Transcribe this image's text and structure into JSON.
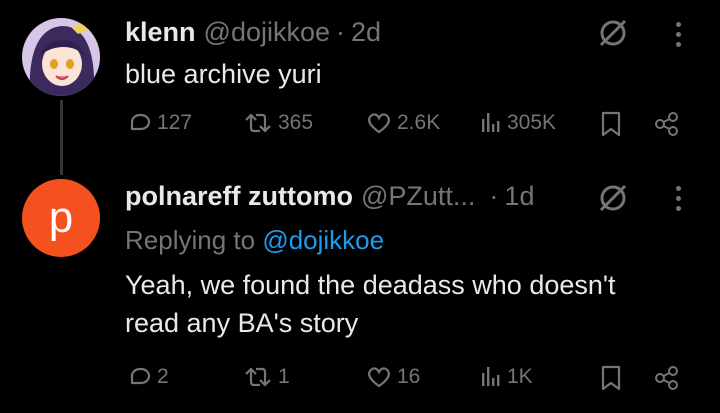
{
  "tweets": [
    {
      "author_name": "klenn",
      "handle": "@dojikkoe",
      "separator": "·",
      "time": "2d",
      "text": "blue archive yuri",
      "avatar_icon": "anime-avatar-icon",
      "actions": {
        "reply_count": "127",
        "retweet_count": "365",
        "like_count": "2.6K",
        "view_count": "305K"
      }
    },
    {
      "author_name": "polnareff zuttomo",
      "handle": "@PZutt...",
      "separator": "·",
      "time": "1d",
      "avatar_letter": "p",
      "replying_prefix": "Replying to",
      "replying_handle": "@dojikkoe",
      "text_line1": "Yeah, we found the deadass who doesn't",
      "text_line2": "read any BA's story",
      "actions": {
        "reply_count": "2",
        "retweet_count": "1",
        "like_count": "16",
        "view_count": "1K"
      }
    }
  ],
  "colors": {
    "background": "#000000",
    "text": "#e7e9ea",
    "muted": "#71767b",
    "link": "#1d9bf0",
    "avatar_orange": "#f4511e"
  }
}
